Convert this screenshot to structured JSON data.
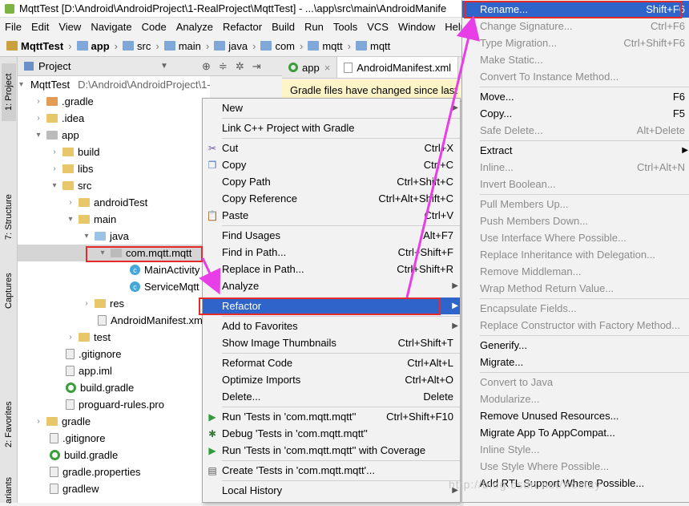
{
  "window": {
    "title": "MqttTest [D:\\Android\\AndroidProject\\1-RealProject\\MqttTest] - ...\\app\\src\\main\\AndroidManife"
  },
  "menubar": [
    "File",
    "Edit",
    "View",
    "Navigate",
    "Code",
    "Analyze",
    "Refactor",
    "Build",
    "Run",
    "Tools",
    "VCS",
    "Window",
    "Help"
  ],
  "breadcrumb": [
    "MqttTest",
    "app",
    "src",
    "main",
    "java",
    "com",
    "mqtt",
    "mqtt"
  ],
  "left_tabs": {
    "project": "1: Project",
    "structure": "7: Structure",
    "captures": "Captures",
    "favorites": "2: Favorites",
    "variants": "ariants"
  },
  "project_panel": {
    "view_label": "Project",
    "tree": [
      {
        "label": "MqttTest",
        "path": "D:\\Android\\AndroidProject\\1-RealProje"
      },
      {
        "label": ".gradle"
      },
      {
        "label": ".idea"
      },
      {
        "label": "app"
      },
      {
        "label": "build"
      },
      {
        "label": "libs"
      },
      {
        "label": "src"
      },
      {
        "label": "androidTest"
      },
      {
        "label": "main"
      },
      {
        "label": "java"
      },
      {
        "label": "com.mqtt.mqtt"
      },
      {
        "label": "MainActivity"
      },
      {
        "label": "ServiceMqtt"
      },
      {
        "label": "res"
      },
      {
        "label": "AndroidManifest.xml"
      },
      {
        "label": "test"
      },
      {
        "label": ".gitignore"
      },
      {
        "label": "app.iml"
      },
      {
        "label": "build.gradle"
      },
      {
        "label": "proguard-rules.pro"
      },
      {
        "label": "gradle"
      },
      {
        "label": ".gitignore"
      },
      {
        "label": "build.gradle"
      },
      {
        "label": "gradle.properties"
      },
      {
        "label": "gradlew"
      }
    ]
  },
  "editor": {
    "tabs": [
      "app",
      "AndroidManifest.xml"
    ],
    "banner": "Gradle files have changed since last"
  },
  "context_menu": [
    {
      "label": "New",
      "shortcut": ""
    },
    {
      "label": "Link C++ Project with Gradle",
      "shortcut": ""
    },
    {
      "label": "Cut",
      "shortcut": "Ctrl+X"
    },
    {
      "label": "Copy",
      "shortcut": "Ctrl+C"
    },
    {
      "label": "Copy Path",
      "shortcut": "Ctrl+Shift+C"
    },
    {
      "label": "Copy Reference",
      "shortcut": "Ctrl+Alt+Shift+C"
    },
    {
      "label": "Paste",
      "shortcut": "Ctrl+V"
    },
    {
      "label": "Find Usages",
      "shortcut": "Alt+F7"
    },
    {
      "label": "Find in Path...",
      "shortcut": "Ctrl+Shift+F"
    },
    {
      "label": "Replace in Path...",
      "shortcut": "Ctrl+Shift+R"
    },
    {
      "label": "Analyze",
      "shortcut": ""
    },
    {
      "label": "Refactor",
      "shortcut": ""
    },
    {
      "label": "Add to Favorites",
      "shortcut": ""
    },
    {
      "label": "Show Image Thumbnails",
      "shortcut": "Ctrl+Shift+T"
    },
    {
      "label": "Reformat Code",
      "shortcut": "Ctrl+Alt+L"
    },
    {
      "label": "Optimize Imports",
      "shortcut": "Ctrl+Alt+O"
    },
    {
      "label": "Delete...",
      "shortcut": "Delete"
    },
    {
      "label": "Run 'Tests in 'com.mqtt.mqtt''",
      "shortcut": "Ctrl+Shift+F10"
    },
    {
      "label": "Debug 'Tests in 'com.mqtt.mqtt''",
      "shortcut": ""
    },
    {
      "label": "Run 'Tests in 'com.mqtt.mqtt'' with Coverage",
      "shortcut": ""
    },
    {
      "label": "Create 'Tests in 'com.mqtt.mqtt'...",
      "shortcut": ""
    },
    {
      "label": "Local History",
      "shortcut": ""
    }
  ],
  "refactor_submenu": [
    {
      "label": "Rename...",
      "shortcut": "Shift+F6"
    },
    {
      "label": "Change Signature...",
      "shortcut": "Ctrl+F6"
    },
    {
      "label": "Type Migration...",
      "shortcut": "Ctrl+Shift+F6"
    },
    {
      "label": "Make Static...",
      "shortcut": ""
    },
    {
      "label": "Convert To Instance Method...",
      "shortcut": ""
    },
    {
      "label": "Move...",
      "shortcut": "F6"
    },
    {
      "label": "Copy...",
      "shortcut": "F5"
    },
    {
      "label": "Safe Delete...",
      "shortcut": "Alt+Delete"
    },
    {
      "label": "Extract",
      "shortcut": ""
    },
    {
      "label": "Inline...",
      "shortcut": "Ctrl+Alt+N"
    },
    {
      "label": "Invert Boolean...",
      "shortcut": ""
    },
    {
      "label": "Pull Members Up...",
      "shortcut": ""
    },
    {
      "label": "Push Members Down...",
      "shortcut": ""
    },
    {
      "label": "Use Interface Where Possible...",
      "shortcut": ""
    },
    {
      "label": "Replace Inheritance with Delegation...",
      "shortcut": ""
    },
    {
      "label": "Remove Middleman...",
      "shortcut": ""
    },
    {
      "label": "Wrap Method Return Value...",
      "shortcut": ""
    },
    {
      "label": "Encapsulate Fields...",
      "shortcut": ""
    },
    {
      "label": "Replace Constructor with Factory Method...",
      "shortcut": ""
    },
    {
      "label": "Generify...",
      "shortcut": ""
    },
    {
      "label": "Migrate...",
      "shortcut": ""
    },
    {
      "label": "Convert to Java",
      "shortcut": ""
    },
    {
      "label": "Modularize...",
      "shortcut": ""
    },
    {
      "label": "Remove Unused Resources...",
      "shortcut": ""
    },
    {
      "label": "Migrate App To AppCompat...",
      "shortcut": ""
    },
    {
      "label": "Inline Style...",
      "shortcut": ""
    },
    {
      "label": "Use Style Where Possible...",
      "shortcut": ""
    },
    {
      "label": "Add RTL Support Where Possible...",
      "shortcut": ""
    }
  ],
  "watermark": "http://blog.csdn.net/Kcclay",
  "colors": {
    "highlight": "#2f65ca",
    "annotation_red": "#e52a2a",
    "annotation_arrow": "#e83ee8"
  }
}
